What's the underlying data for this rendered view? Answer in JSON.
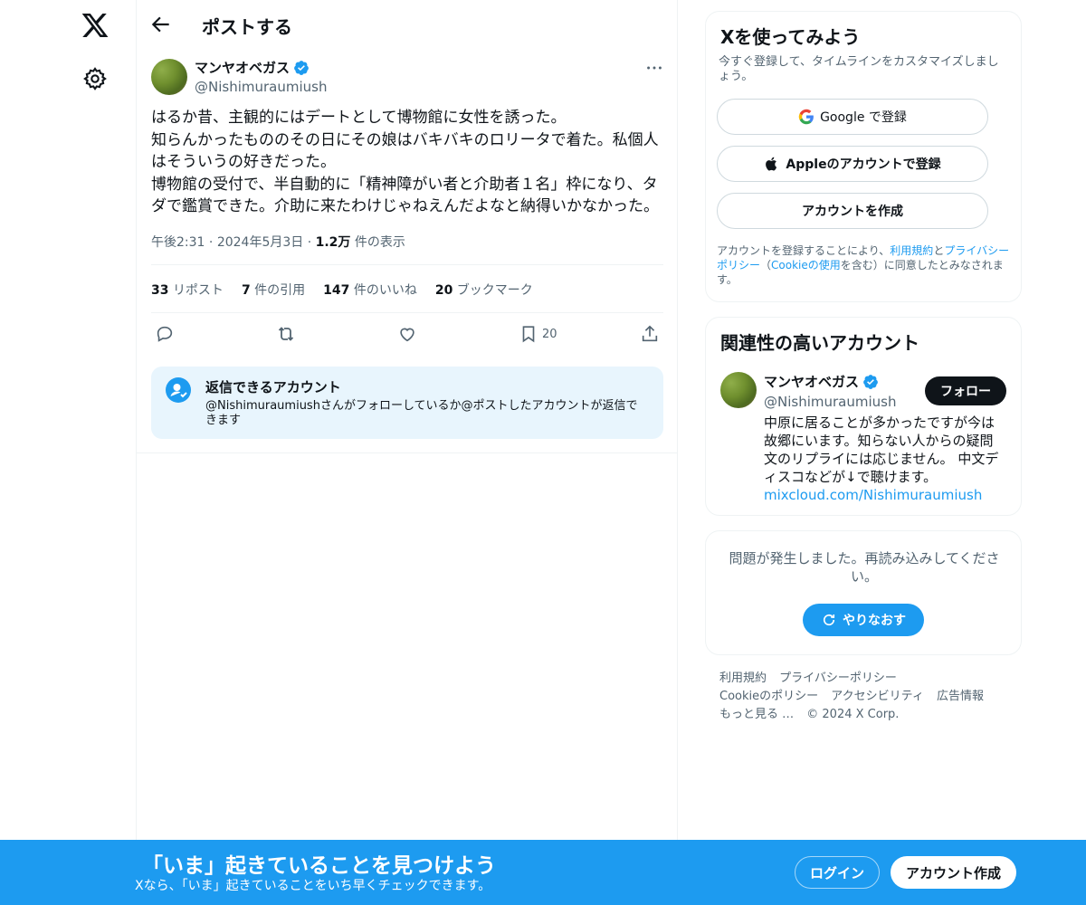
{
  "header": {
    "title": "ポストする"
  },
  "post": {
    "author_name": "マンヤオベガス",
    "author_handle": "@Nishimuraumiush",
    "text_lines": [
      "はるか昔、主観的にはデートとして博物館に女性を誘った。",
      "知らんかったもののその日にその娘はバキバキのロリータで着た。私個人",
      "はそういうの好きだった。",
      "博物館の受付で、半自動的に「精神障がい者と介助者１名」枠になり、タ",
      "ダで鑑賞できた。介助に来たわけじゃねえんだよなと納得いかなかった。"
    ],
    "time": "午後2:31",
    "date": "2024年5月3日",
    "views_count": "1.2万",
    "views_label": "件の表示",
    "stats": [
      {
        "count": "33",
        "label": "リポスト"
      },
      {
        "count": "7",
        "label": "件の引用"
      },
      {
        "count": "147",
        "label": "件のいいね"
      },
      {
        "count": "20",
        "label": "ブックマーク"
      }
    ],
    "bookmark_count": "20"
  },
  "reply_restriction": {
    "title": "返信できるアカウント",
    "description": "@Nishimuraumiushさんがフォローしているか@ポストしたアカウントが返信できます"
  },
  "signup": {
    "title": "Xを使ってみよう",
    "subtitle": "今すぐ登録して、タイムラインをカスタマイズしましょう。",
    "google_label": "Google で登録",
    "apple_label": "Appleのアカウントで登録",
    "create_label": "アカウントを作成",
    "terms_prefix": "アカウントを登録することにより、",
    "terms_link": "利用規約",
    "terms_and": "と",
    "privacy_link": "プライバシーポリシー",
    "terms_paren_open": "（",
    "cookie_link": "Cookieの使用",
    "terms_suffix": "を含む）に同意したとみなされます。"
  },
  "related": {
    "title": "関連性の高いアカウント",
    "name": "マンヤオベガス",
    "handle": "@Nishimuraumiush",
    "follow_label": "フォロー",
    "bio_lines": [
      "中原に居ることが多かったですが今は",
      "故郷にいます。知らない人からの疑問",
      "文のリプライには応じません。 中文デ",
      "ィスコなどが↓で聴けます。"
    ],
    "bio_link": "mixcloud.com/Nishimuraumiush"
  },
  "error": {
    "message": "問題が発生しました。再読み込みしてください。",
    "retry_label": "やりなおす"
  },
  "footer": {
    "links": [
      "利用規約",
      "プライバシーポリシー",
      "Cookieのポリシー",
      "アクセシビリティ",
      "広告情報",
      "もっと見る …",
      "© 2024 X Corp."
    ]
  },
  "bottom_bar": {
    "title": "「いま」起きていることを見つけよう",
    "subtitle": "Xなら、「いま」起きていることをいち早くチェックできます。",
    "login_label": "ログイン",
    "create_label": "アカウント作成"
  },
  "colors": {
    "accent": "#1d9bf0",
    "text": "#0f1419",
    "muted": "#536471",
    "verified": "#1d9bf0"
  }
}
